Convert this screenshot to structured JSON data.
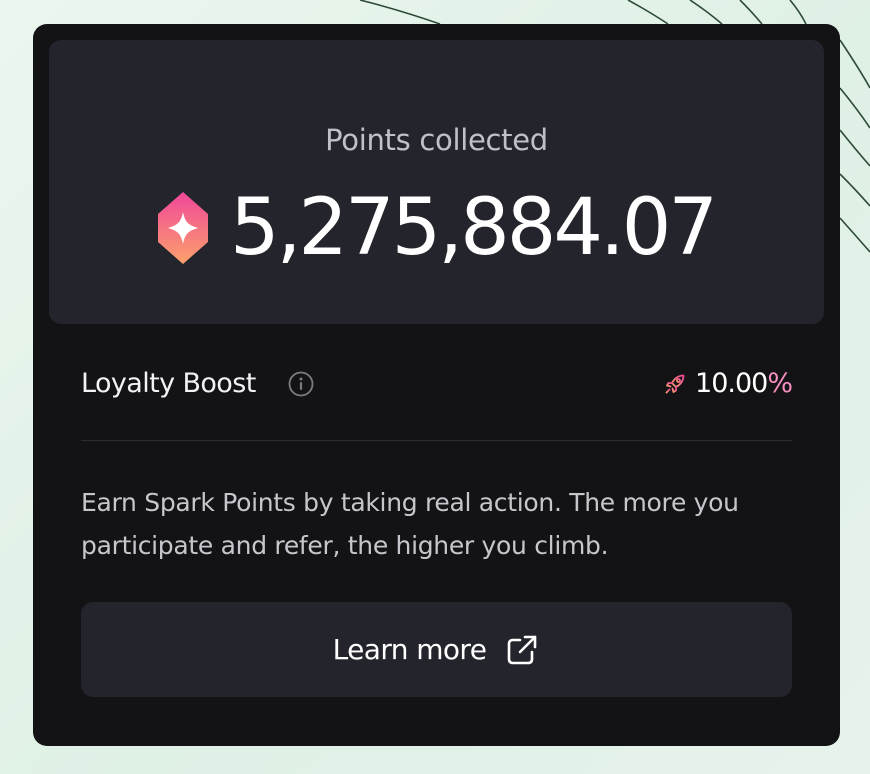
{
  "points_panel": {
    "label": "Points collected",
    "value": "5,275,884.07",
    "icon": "spark-gem-icon"
  },
  "loyalty_boost": {
    "title": "Loyalty Boost",
    "info_icon": "info-icon",
    "boost_icon": "rocket-icon",
    "value_number": "10.00",
    "value_unit": "%"
  },
  "description": "Earn Spark Points by taking real action. The more you participate and refer, the higher you climb.",
  "learn_more": {
    "label": "Learn more",
    "icon": "external-link-icon"
  },
  "colors": {
    "card_bg": "#131316",
    "panel_bg": "#24252c",
    "accent_pink": "#f58fc0",
    "gem_gradient_top": "#f0479a",
    "gem_gradient_bottom": "#fca16b"
  }
}
